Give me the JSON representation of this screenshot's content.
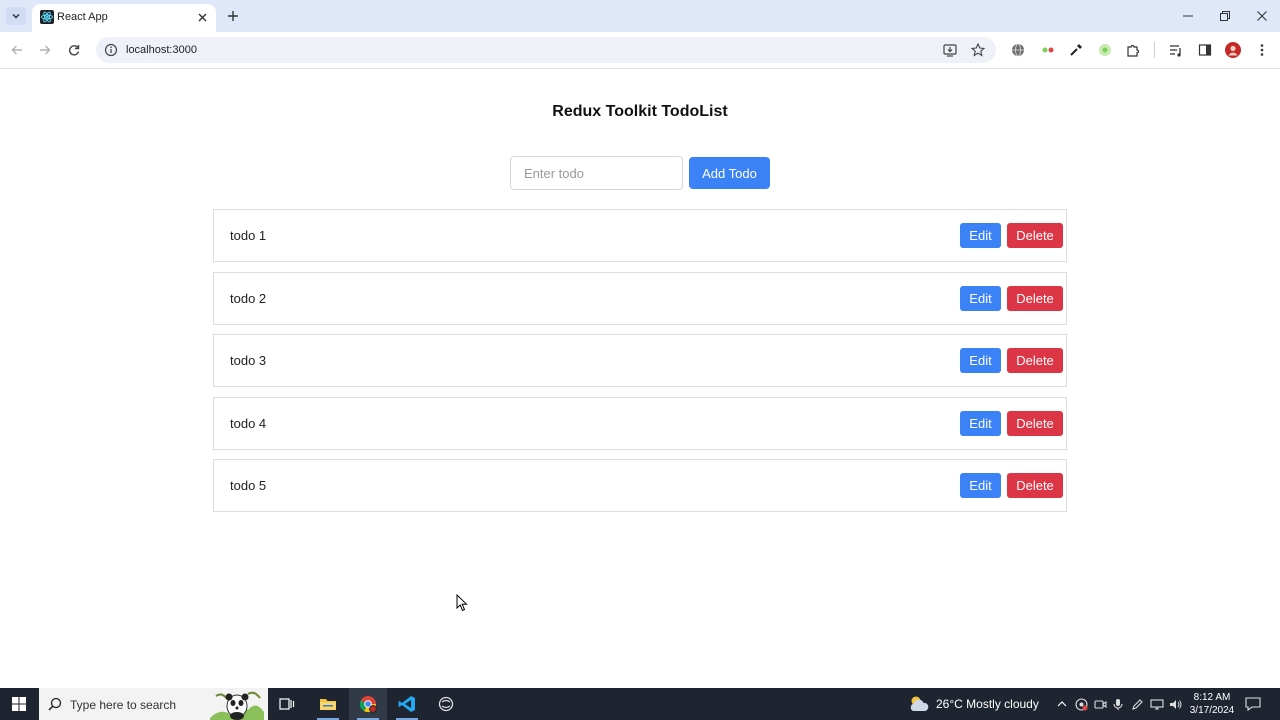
{
  "browser": {
    "tab_title": "React App",
    "url": "localhost:3000"
  },
  "page": {
    "title": "Redux Toolkit TodoList",
    "input_placeholder": "Enter todo",
    "input_value": "",
    "add_label": "Add Todo",
    "edit_label": "Edit",
    "delete_label": "Delete",
    "todos": [
      "todo 1",
      "todo 2",
      "todo 3",
      "todo 4",
      "todo 5"
    ]
  },
  "taskbar": {
    "search_placeholder": "Type here to search",
    "weather_text": "26°C  Mostly cloudy",
    "time": "8:12 AM",
    "date": "3/17/2024"
  },
  "colors": {
    "primary": "#3b82f6",
    "danger": "#dc3545",
    "tabbar": "#dfe8f8",
    "taskbar": "#1f2530"
  }
}
